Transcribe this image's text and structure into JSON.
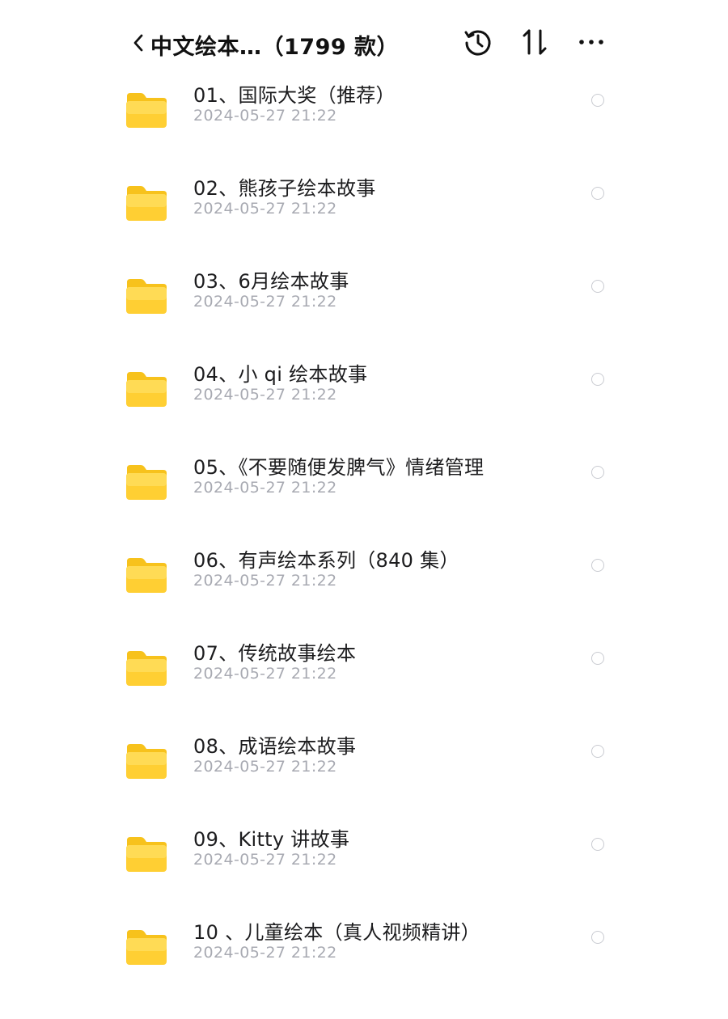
{
  "header": {
    "title": "中文绘本…（1799 款）",
    "icons": {
      "back": "chevron-left-icon",
      "history": "history-icon",
      "sort": "sort-icon",
      "more": "more-icon"
    }
  },
  "items": [
    {
      "name": "01、国际大奖（推荐）",
      "date": "2024-05-27 21:22"
    },
    {
      "name": "02、熊孩子绘本故事",
      "date": "2024-05-27 21:22"
    },
    {
      "name": "03、6月绘本故事",
      "date": "2024-05-27 21:22"
    },
    {
      "name": "04、小 qi 绘本故事",
      "date": "2024-05-27 21:22"
    },
    {
      "name": "05、《不要随便发脾气》情绪管理",
      "date": "2024-05-27 21:22"
    },
    {
      "name": "06、有声绘本系列（840 集）",
      "date": "2024-05-27 21:22"
    },
    {
      "name": "07、传统故事绘本",
      "date": "2024-05-27 21:22"
    },
    {
      "name": "08、成语绘本故事",
      "date": "2024-05-27 21:22"
    },
    {
      "name": "09、Kitty 讲故事",
      "date": "2024-05-27 21:22"
    },
    {
      "name": "10 、儿童绘本（真人视频精讲）",
      "date": "2024-05-27 21:22"
    }
  ],
  "colors": {
    "folder_top": "#ffd84a",
    "folder_bottom": "#ffc927",
    "folder_tab": "#f7c21c",
    "date_text": "#a8aab2",
    "radio_border": "#c9cbd1"
  }
}
